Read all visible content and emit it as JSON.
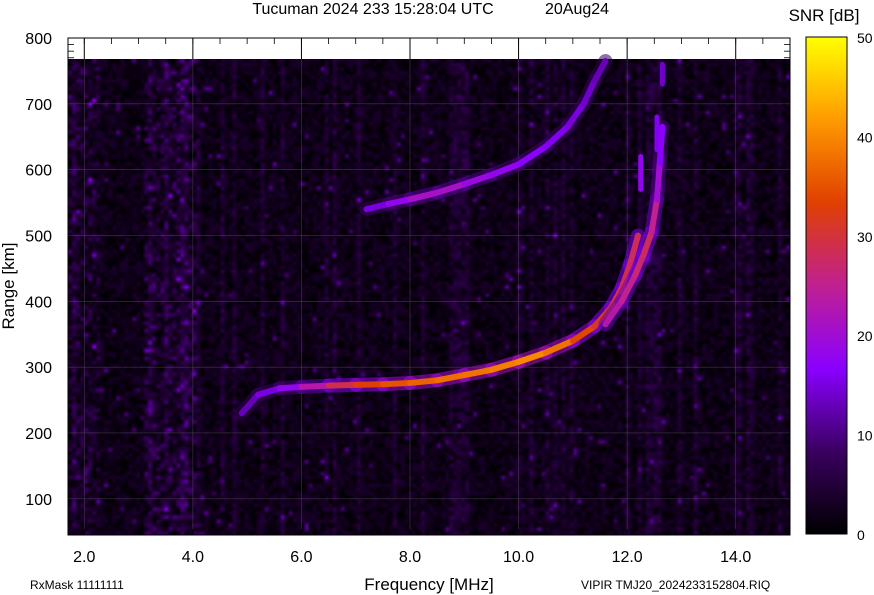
{
  "header": {
    "title": "Tucuman 2024 233 15:28:04 UTC",
    "date": "20Aug24"
  },
  "footer": {
    "rxmask": "RxMask 11111111",
    "file": "VIPIR  TMJ20_2024233152804.RIQ"
  },
  "chart_data": {
    "type": "heatmap",
    "xlabel": "Frequency [MHz]",
    "ylabel": "Range [km]",
    "xlim": [
      1.7,
      15.0
    ],
    "ylim": [
      45,
      800
    ],
    "xticks": [
      "2.0",
      "4.0",
      "6.0",
      "8.0",
      "10.0",
      "12.0",
      "14.0"
    ],
    "yticks": [
      "100",
      "200",
      "300",
      "400",
      "500",
      "600",
      "700",
      "800"
    ],
    "colorbar": {
      "label": "SNR [dB]",
      "range": [
        0,
        50
      ],
      "ticks": [
        "0",
        "10",
        "20",
        "30",
        "40",
        "50"
      ],
      "colors": [
        "#000000",
        "#3a0060",
        "#8a00ff",
        "#c02090",
        "#e04000",
        "#ff9a00",
        "#ffff00"
      ]
    },
    "grid": true,
    "traces": [
      {
        "name": "",
        "points": [
          [
            4.9,
            230
          ],
          [
            5.2,
            258
          ],
          [
            5.6,
            268
          ],
          [
            6.0,
            270
          ],
          [
            6.5,
            272
          ],
          [
            7.0,
            273
          ],
          [
            7.5,
            274
          ],
          [
            8.0,
            276
          ],
          [
            8.5,
            280
          ],
          [
            9.0,
            288
          ],
          [
            9.5,
            296
          ],
          [
            10.0,
            308
          ],
          [
            10.5,
            322
          ],
          [
            11.0,
            340
          ],
          [
            11.4,
            362
          ],
          [
            11.7,
            390
          ],
          [
            11.9,
            420
          ],
          [
            12.05,
            455
          ],
          [
            12.2,
            500
          ]
        ],
        "snr": [
          12,
          14,
          16,
          20,
          26,
          32,
          34,
          36,
          37,
          38,
          38,
          40,
          40,
          36,
          32,
          30,
          30,
          28,
          28
        ]
      },
      {
        "name": "",
        "points": [
          [
            11.6,
            365
          ],
          [
            11.9,
            400
          ],
          [
            12.15,
            440
          ],
          [
            12.3,
            470
          ],
          [
            12.45,
            505
          ],
          [
            12.55,
            555
          ],
          [
            12.6,
            610
          ],
          [
            12.65,
            665
          ]
        ],
        "snr": [
          22,
          24,
          26,
          28,
          28,
          22,
          18,
          16
        ]
      },
      {
        "name": "",
        "points": [
          [
            7.2,
            540
          ],
          [
            7.6,
            548
          ],
          [
            8.0,
            555
          ],
          [
            8.5,
            565
          ],
          [
            9.0,
            578
          ],
          [
            9.5,
            592
          ],
          [
            10.0,
            608
          ],
          [
            10.5,
            635
          ],
          [
            10.9,
            665
          ],
          [
            11.2,
            700
          ],
          [
            11.4,
            735
          ],
          [
            11.6,
            765
          ]
        ],
        "snr": [
          14,
          16,
          20,
          22,
          20,
          18,
          18,
          16,
          16,
          14,
          14,
          12
        ]
      }
    ],
    "extra_echoes": [
      {
        "freq": 12.25,
        "range": [
          570,
          620
        ],
        "snr": 18
      },
      {
        "freq": 12.55,
        "range": [
          630,
          680
        ],
        "snr": 16
      },
      {
        "freq": 12.65,
        "range": [
          730,
          760
        ],
        "snr": 14
      }
    ]
  }
}
